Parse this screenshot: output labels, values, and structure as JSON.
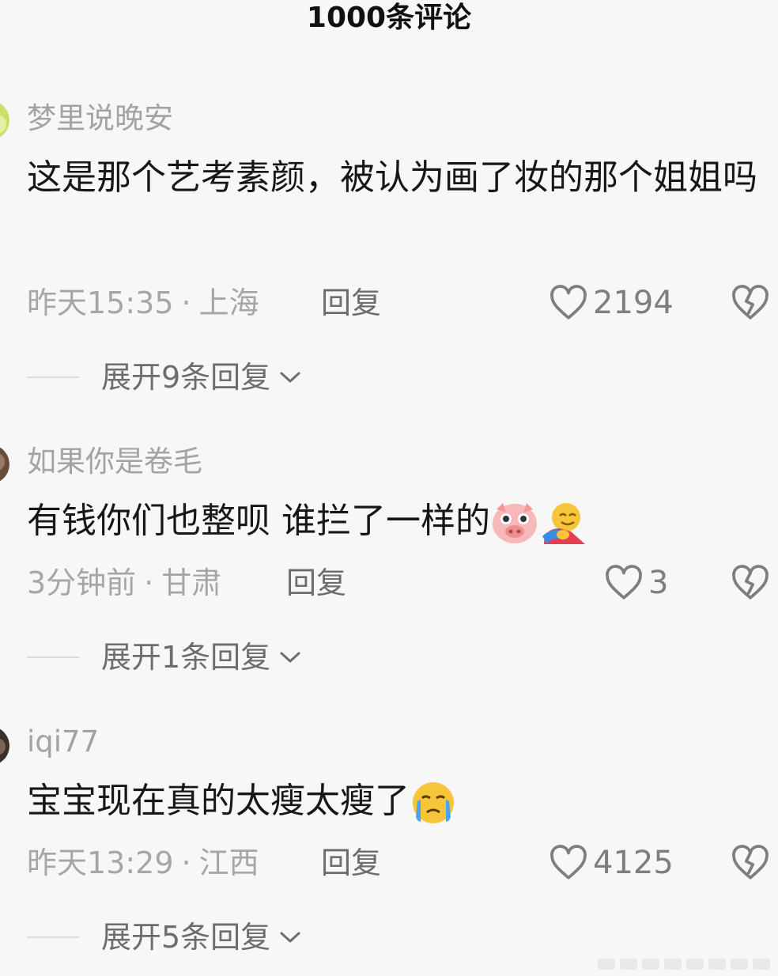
{
  "header": {
    "title": "1000条评论"
  },
  "comments": [
    {
      "username": "梦里说晚安",
      "text": "这是那个艺考素颜，被认为画了妆的那个姐姐吗",
      "time": "昨天15:35",
      "dot": "·",
      "location": "上海",
      "reply_label": "回复",
      "likes": "2194",
      "expand_label": "展开9条回复"
    },
    {
      "username": "如果你是卷毛",
      "text": "有钱你们也整呗 谁拦了一样的",
      "emojis": [
        "pig-face-emoji",
        "hug-emoji"
      ],
      "time": "3分钟前",
      "dot": "·",
      "location": "甘肃",
      "reply_label": "回复",
      "likes": "3",
      "expand_label": "展开1条回复"
    },
    {
      "username": "iqi77",
      "text": "宝宝现在真的太瘦太瘦了",
      "emojis": [
        "crying-face-emoji"
      ],
      "time": "昨天13:29",
      "dot": "·",
      "location": "江西",
      "reply_label": "回复",
      "likes": "4125",
      "expand_label": "展开5条回复"
    }
  ],
  "colors": {
    "background": "#f7f7f7",
    "text": "#171717",
    "meta": "#a6a6a6",
    "action": "#6d6d6d"
  }
}
